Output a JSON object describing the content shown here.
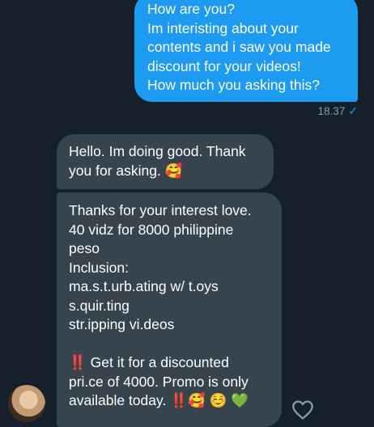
{
  "outgoing_message": {
    "lines": [
      "How are you?",
      "Im interisting about your",
      "contents and i saw you made",
      "discount for your videos!",
      "How much you asking this?"
    ],
    "time": "18.37",
    "status_icon": "checkmark-icon"
  },
  "incoming_message_1": {
    "lines": [
      "Hello. Im doing good. Thank",
      "you for asking. 🥰"
    ]
  },
  "incoming_message_2": {
    "lines": [
      "Thanks for your interest love.",
      "40 vidz for 8000 philippine",
      "peso",
      "Inclusion:",
      "ma.s.t.urb.ating w/ t.oys",
      "s.quir.ting",
      "str.ipping vi.deos",
      "",
      "‼️ Get it for a discounted",
      "pri.ce of 4000. Promo is only",
      "available today. ‼️🥰 ☺️ 💚"
    ]
  },
  "colors": {
    "background": "#15202b",
    "outgoing_bubble": "#1d9bf0",
    "incoming_bubble": "#38444d"
  }
}
